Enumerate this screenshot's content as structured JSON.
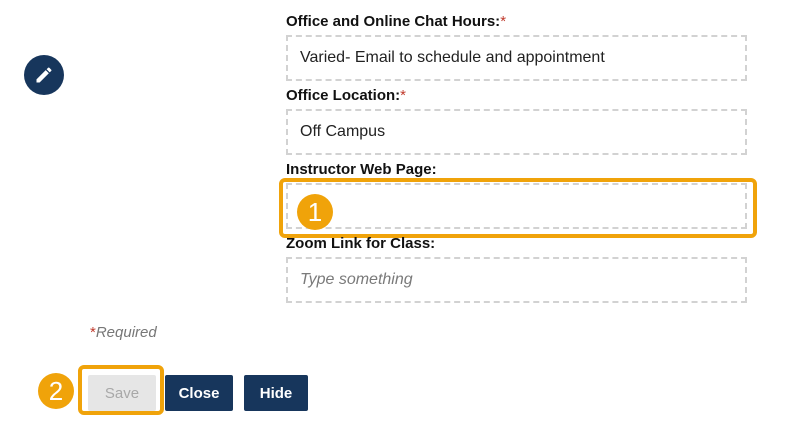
{
  "fields": [
    {
      "label": "Office and Online Chat Hours:",
      "required": true,
      "value": "Varied- Email to schedule and appointment",
      "placeholder": ""
    },
    {
      "label": "Office Location:",
      "required": true,
      "value": "Off Campus",
      "placeholder": ""
    },
    {
      "label": "Instructor Web Page:",
      "required": false,
      "value": "",
      "placeholder": ""
    },
    {
      "label": "Zoom Link for Class:",
      "required": false,
      "value": "",
      "placeholder": "Type something"
    }
  ],
  "required_asterisk": "*",
  "required_note": "Required",
  "buttons": {
    "save": "Save",
    "close": "Close",
    "hide": "Hide"
  },
  "callouts": {
    "one": "1",
    "two": "2"
  },
  "icons": {
    "edit": "pencil-icon"
  },
  "colors": {
    "primary": "#17365c",
    "highlight": "#f0a30a",
    "required": "#c0392b"
  }
}
